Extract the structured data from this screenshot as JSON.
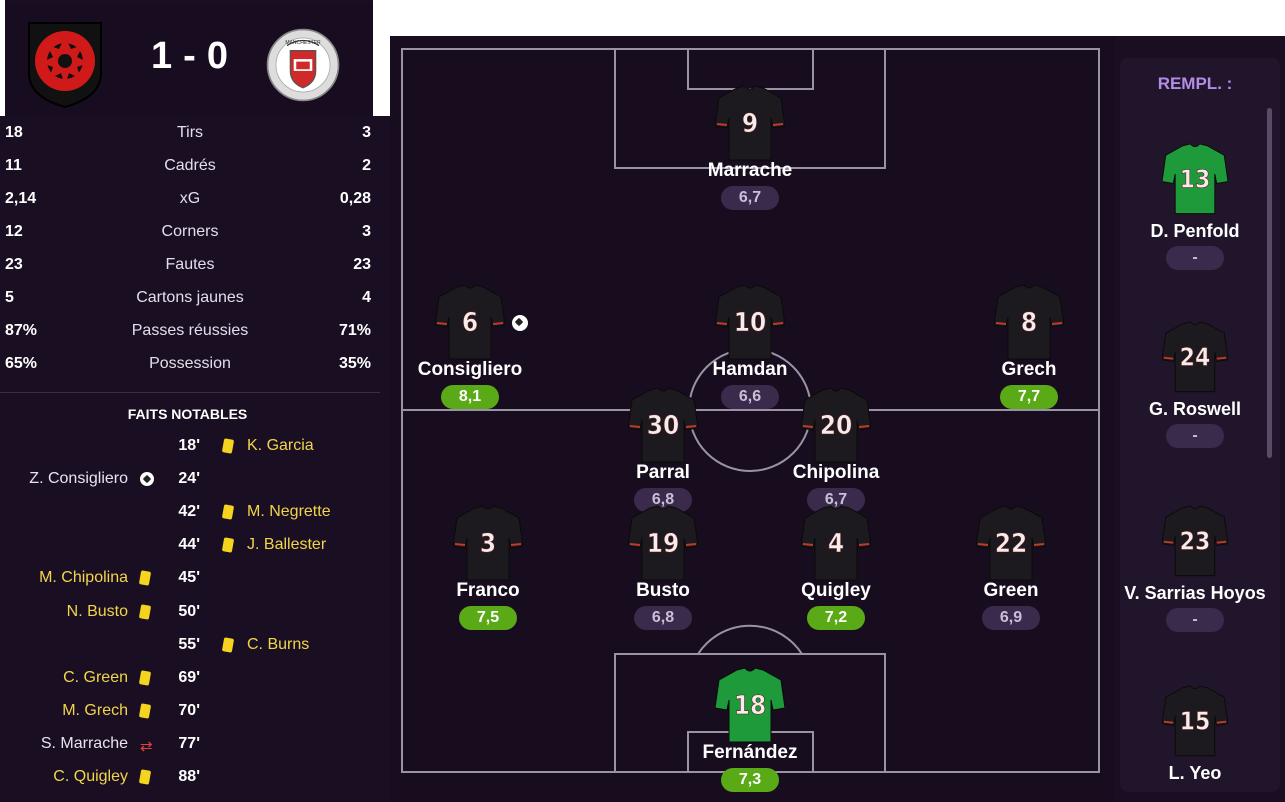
{
  "match": {
    "home_score": "1",
    "away_score": "0",
    "separator": "-",
    "away_crest_text": "MANCHESTER"
  },
  "stats": [
    {
      "home": "18",
      "label": "Tirs",
      "away": "3"
    },
    {
      "home": "11",
      "label": "Cadrés",
      "away": "2"
    },
    {
      "home": "2,14",
      "label": "xG",
      "away": "0,28"
    },
    {
      "home": "12",
      "label": "Corners",
      "away": "3"
    },
    {
      "home": "23",
      "label": "Fautes",
      "away": "23"
    },
    {
      "home": "5",
      "label": "Cartons jaunes",
      "away": "4"
    },
    {
      "home": "87%",
      "label": "Passes réussies",
      "away": "71%"
    },
    {
      "home": "65%",
      "label": "Possession",
      "away": "35%"
    }
  ],
  "events_title": "FAITS NOTABLES",
  "events": [
    {
      "minute": "18'",
      "side": "away",
      "type": "yellow-card",
      "player": "K. Garcia"
    },
    {
      "minute": "24'",
      "side": "home",
      "type": "goal",
      "player": "Z. Consigliero"
    },
    {
      "minute": "42'",
      "side": "away",
      "type": "yellow-card",
      "player": "M. Negrette"
    },
    {
      "minute": "44'",
      "side": "away",
      "type": "yellow-card",
      "player": "J. Ballester"
    },
    {
      "minute": "45'",
      "side": "home",
      "type": "yellow-card",
      "player": "M. Chipolina"
    },
    {
      "minute": "50'",
      "side": "home",
      "type": "yellow-card",
      "player": "N. Busto"
    },
    {
      "minute": "55'",
      "side": "away",
      "type": "yellow-card",
      "player": "C. Burns"
    },
    {
      "minute": "69'",
      "side": "home",
      "type": "yellow-card",
      "player": "C. Green"
    },
    {
      "minute": "70'",
      "side": "home",
      "type": "yellow-card",
      "player": "M. Grech"
    },
    {
      "minute": "77'",
      "side": "home",
      "type": "substitution",
      "player": "S. Marrache"
    },
    {
      "minute": "88'",
      "side": "home",
      "type": "yellow-card",
      "player": "C. Quigley"
    }
  ],
  "lineup": [
    {
      "number": "9",
      "name": "Marrache",
      "rating": "6,7",
      "good": false,
      "kit": "outfield"
    },
    {
      "number": "6",
      "name": "Consigliero",
      "rating": "8,1",
      "good": true,
      "kit": "outfield",
      "scored": true
    },
    {
      "number": "10",
      "name": "Hamdan",
      "rating": "6,6",
      "good": false,
      "kit": "outfield"
    },
    {
      "number": "8",
      "name": "Grech",
      "rating": "7,7",
      "good": true,
      "kit": "outfield"
    },
    {
      "number": "30",
      "name": "Parral",
      "rating": "6,8",
      "good": false,
      "kit": "outfield"
    },
    {
      "number": "20",
      "name": "Chipolina",
      "rating": "6,7",
      "good": false,
      "kit": "outfield"
    },
    {
      "number": "3",
      "name": "Franco",
      "rating": "7,5",
      "good": true,
      "kit": "outfield"
    },
    {
      "number": "19",
      "name": "Busto",
      "rating": "6,8",
      "good": false,
      "kit": "outfield"
    },
    {
      "number": "4",
      "name": "Quigley",
      "rating": "7,2",
      "good": true,
      "kit": "outfield"
    },
    {
      "number": "22",
      "name": "Green",
      "rating": "6,9",
      "good": false,
      "kit": "outfield"
    },
    {
      "number": "18",
      "name": "Fernández",
      "rating": "7,3",
      "good": true,
      "kit": "goalkeeper"
    }
  ],
  "subs_title": "REMPL. :",
  "subs": [
    {
      "number": "13",
      "name": "D. Penfold",
      "rating": "-",
      "kit": "goalkeeper"
    },
    {
      "number": "24",
      "name": "G. Roswell",
      "rating": "-",
      "kit": "outfield"
    },
    {
      "number": "23",
      "name": "V. Sarrias Hoyos",
      "rating": "-",
      "kit": "outfield"
    },
    {
      "number": "15",
      "name": "L. Yeo",
      "rating": "",
      "kit": "outfield"
    }
  ],
  "colors": {
    "background": "#1a0f22",
    "rating_good": "#5aaa17",
    "rating_neutral": "#3a2a4c",
    "yellow_card": "#f4d41e",
    "kit_outfield": "#1c1a1e",
    "kit_goalkeeper": "#1f9a3a",
    "subs_title": "#b38ce6"
  }
}
